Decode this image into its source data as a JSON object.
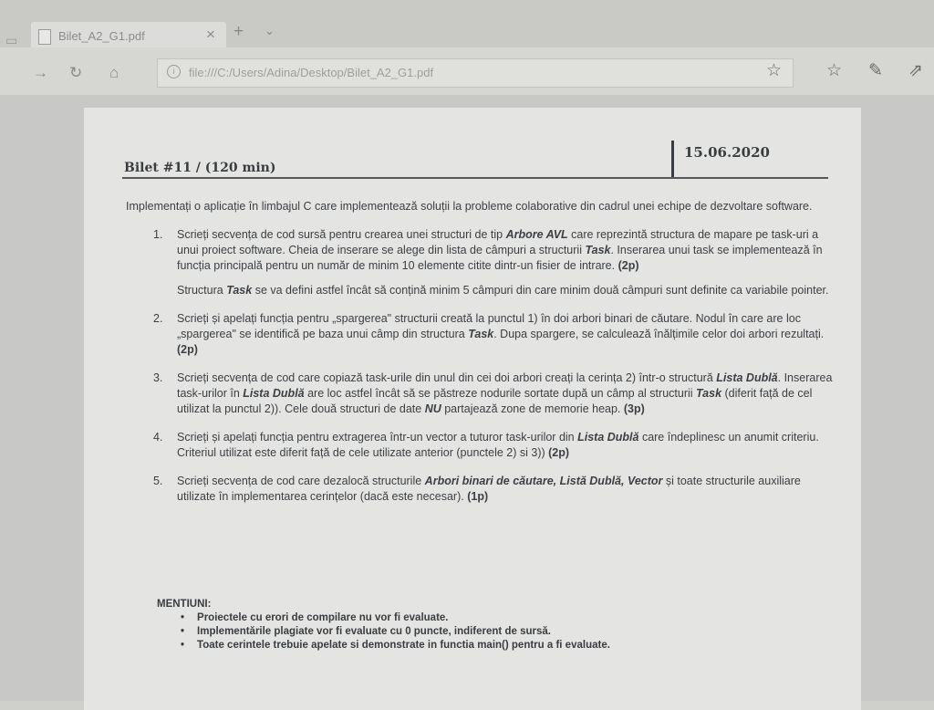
{
  "browser": {
    "tab_title": "Bilet_A2_G1.pdf",
    "close_glyph": "×",
    "new_tab_glyph": "+",
    "url": "file:///C:/Users/Adina/Desktop/Bilet_A2_G1.pdf",
    "icons": [
      "back-icon",
      "refresh-icon",
      "home-icon",
      "info-icon",
      "favorite-star-icon",
      "favorites-list-icon",
      "pen-icon",
      "share-icon"
    ]
  },
  "document": {
    "title": "Bilet #11 / (120 min)",
    "date": "15.06.2020",
    "intro": "Implementați o aplicație în limbajul C care implementează soluții la probleme colaborative din cadrul unei echipe de dezvoltare software.",
    "items": [
      {
        "num": "1.",
        "p1_a": "Scrieți secvența de cod sursă pentru crearea unei structuri de tip ",
        "p1_b": "Arbore AVL",
        "p1_c": " care reprezintă structura de mapare pe task-uri a unui proiect software. Cheia de inserare se alege din lista de câmpuri a structurii ",
        "p1_d": "Task",
        "p1_e": ". Inserarea unui task se implementează în funcția principală pentru un număr de minim 10 elemente citite dintr-un fisier de intrare. ",
        "points": "(2p)",
        "sub_a": "Structura ",
        "sub_b": "Task",
        "sub_c": " se va defini astfel încât să conțină minim 5 câmpuri din care minim două câmpuri sunt definite ca variabile pointer."
      },
      {
        "num": "2.",
        "p1_a": "Scrieți și apelați funcția pentru „spargerea\" structurii creată la punctul 1) în doi arbori binari de căutare. Nodul în care are loc „spargerea\" se identifică pe baza unui câmp din structura ",
        "p1_b": "Task",
        "p1_c": ". Dupa spargere, se calculează înălțimile celor doi arbori rezultați. ",
        "points": "(2p)"
      },
      {
        "num": "3.",
        "p1_a": "Scrieți secvența de cod care copiază task-urile din unul din cei doi arbori creați la cerința 2) într-o structură ",
        "p1_b": "Lista Dublă",
        "p1_c": ". Inserarea task-urilor în ",
        "p1_d": "Lista Dublă",
        "p1_e": " are loc astfel încât să se păstreze nodurile sortate după un câmp al structurii ",
        "p1_f": "Task",
        "p1_g": " (diferit față de cel utilizat la punctul 2)). Cele două structuri de date ",
        "p1_h": "NU",
        "p1_i": " partajează zone de memorie heap. ",
        "points": "(3p)"
      },
      {
        "num": "4.",
        "p1_a": "Scrieți și apelați funcția pentru extragerea într-un vector a tuturor task-urilor din ",
        "p1_b": "Lista Dublă",
        "p1_c": " care îndeplinesc un anumit criteriu. Criteriul utilizat este diferit față de cele utilizate anterior (punctele 2) si 3)) ",
        "points": "(2p)"
      },
      {
        "num": "5.",
        "p1_a": "Scrieți secvența de cod care dezalocă structurile ",
        "p1_b": "Arbori binari de căutare, Listă Dublă, Vector",
        "p1_c": " și toate structurile auxiliare utilizate în implementarea cerințelor (dacă este necesar). ",
        "points": "(1p)"
      }
    ],
    "notes_title": "MENTIUNI:",
    "notes": [
      "Proiectele cu erori de compilare nu vor fi evaluate.",
      "Implementările plagiate vor fi evaluate cu 0 puncte, indiferent de sursă.",
      "Toate cerintele trebuie apelate si demonstrate in functia main() pentru a fi evaluate."
    ]
  }
}
